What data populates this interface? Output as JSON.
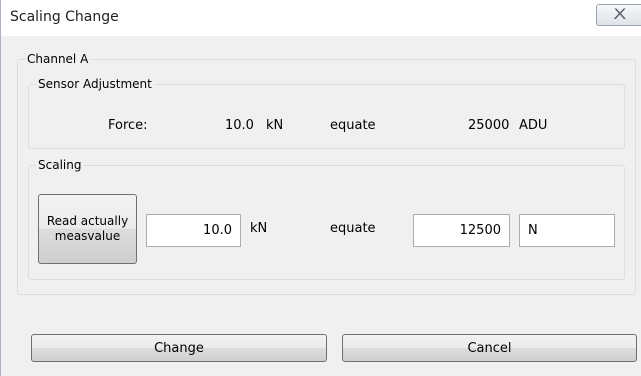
{
  "window": {
    "title": "Scaling Change",
    "close_glyph": "X"
  },
  "channel": {
    "legend": "Channel A"
  },
  "sensor_adjustment": {
    "legend": "Sensor Adjustment",
    "label": "Force:",
    "value": "10.0",
    "unit": "kN",
    "relation": "equate",
    "equivalent_value": "25000",
    "equivalent_unit": "ADU"
  },
  "scaling": {
    "legend": "Scaling",
    "read_button_label": "Read actually\nmeasvalue",
    "force_value": "10.0",
    "force_unit": "kN",
    "relation": "equate",
    "scaled_value": "12500",
    "scaled_unit": "N"
  },
  "actions": {
    "change_label": "Change",
    "cancel_label": "Cancel"
  },
  "icons": {
    "close": "close-icon"
  }
}
